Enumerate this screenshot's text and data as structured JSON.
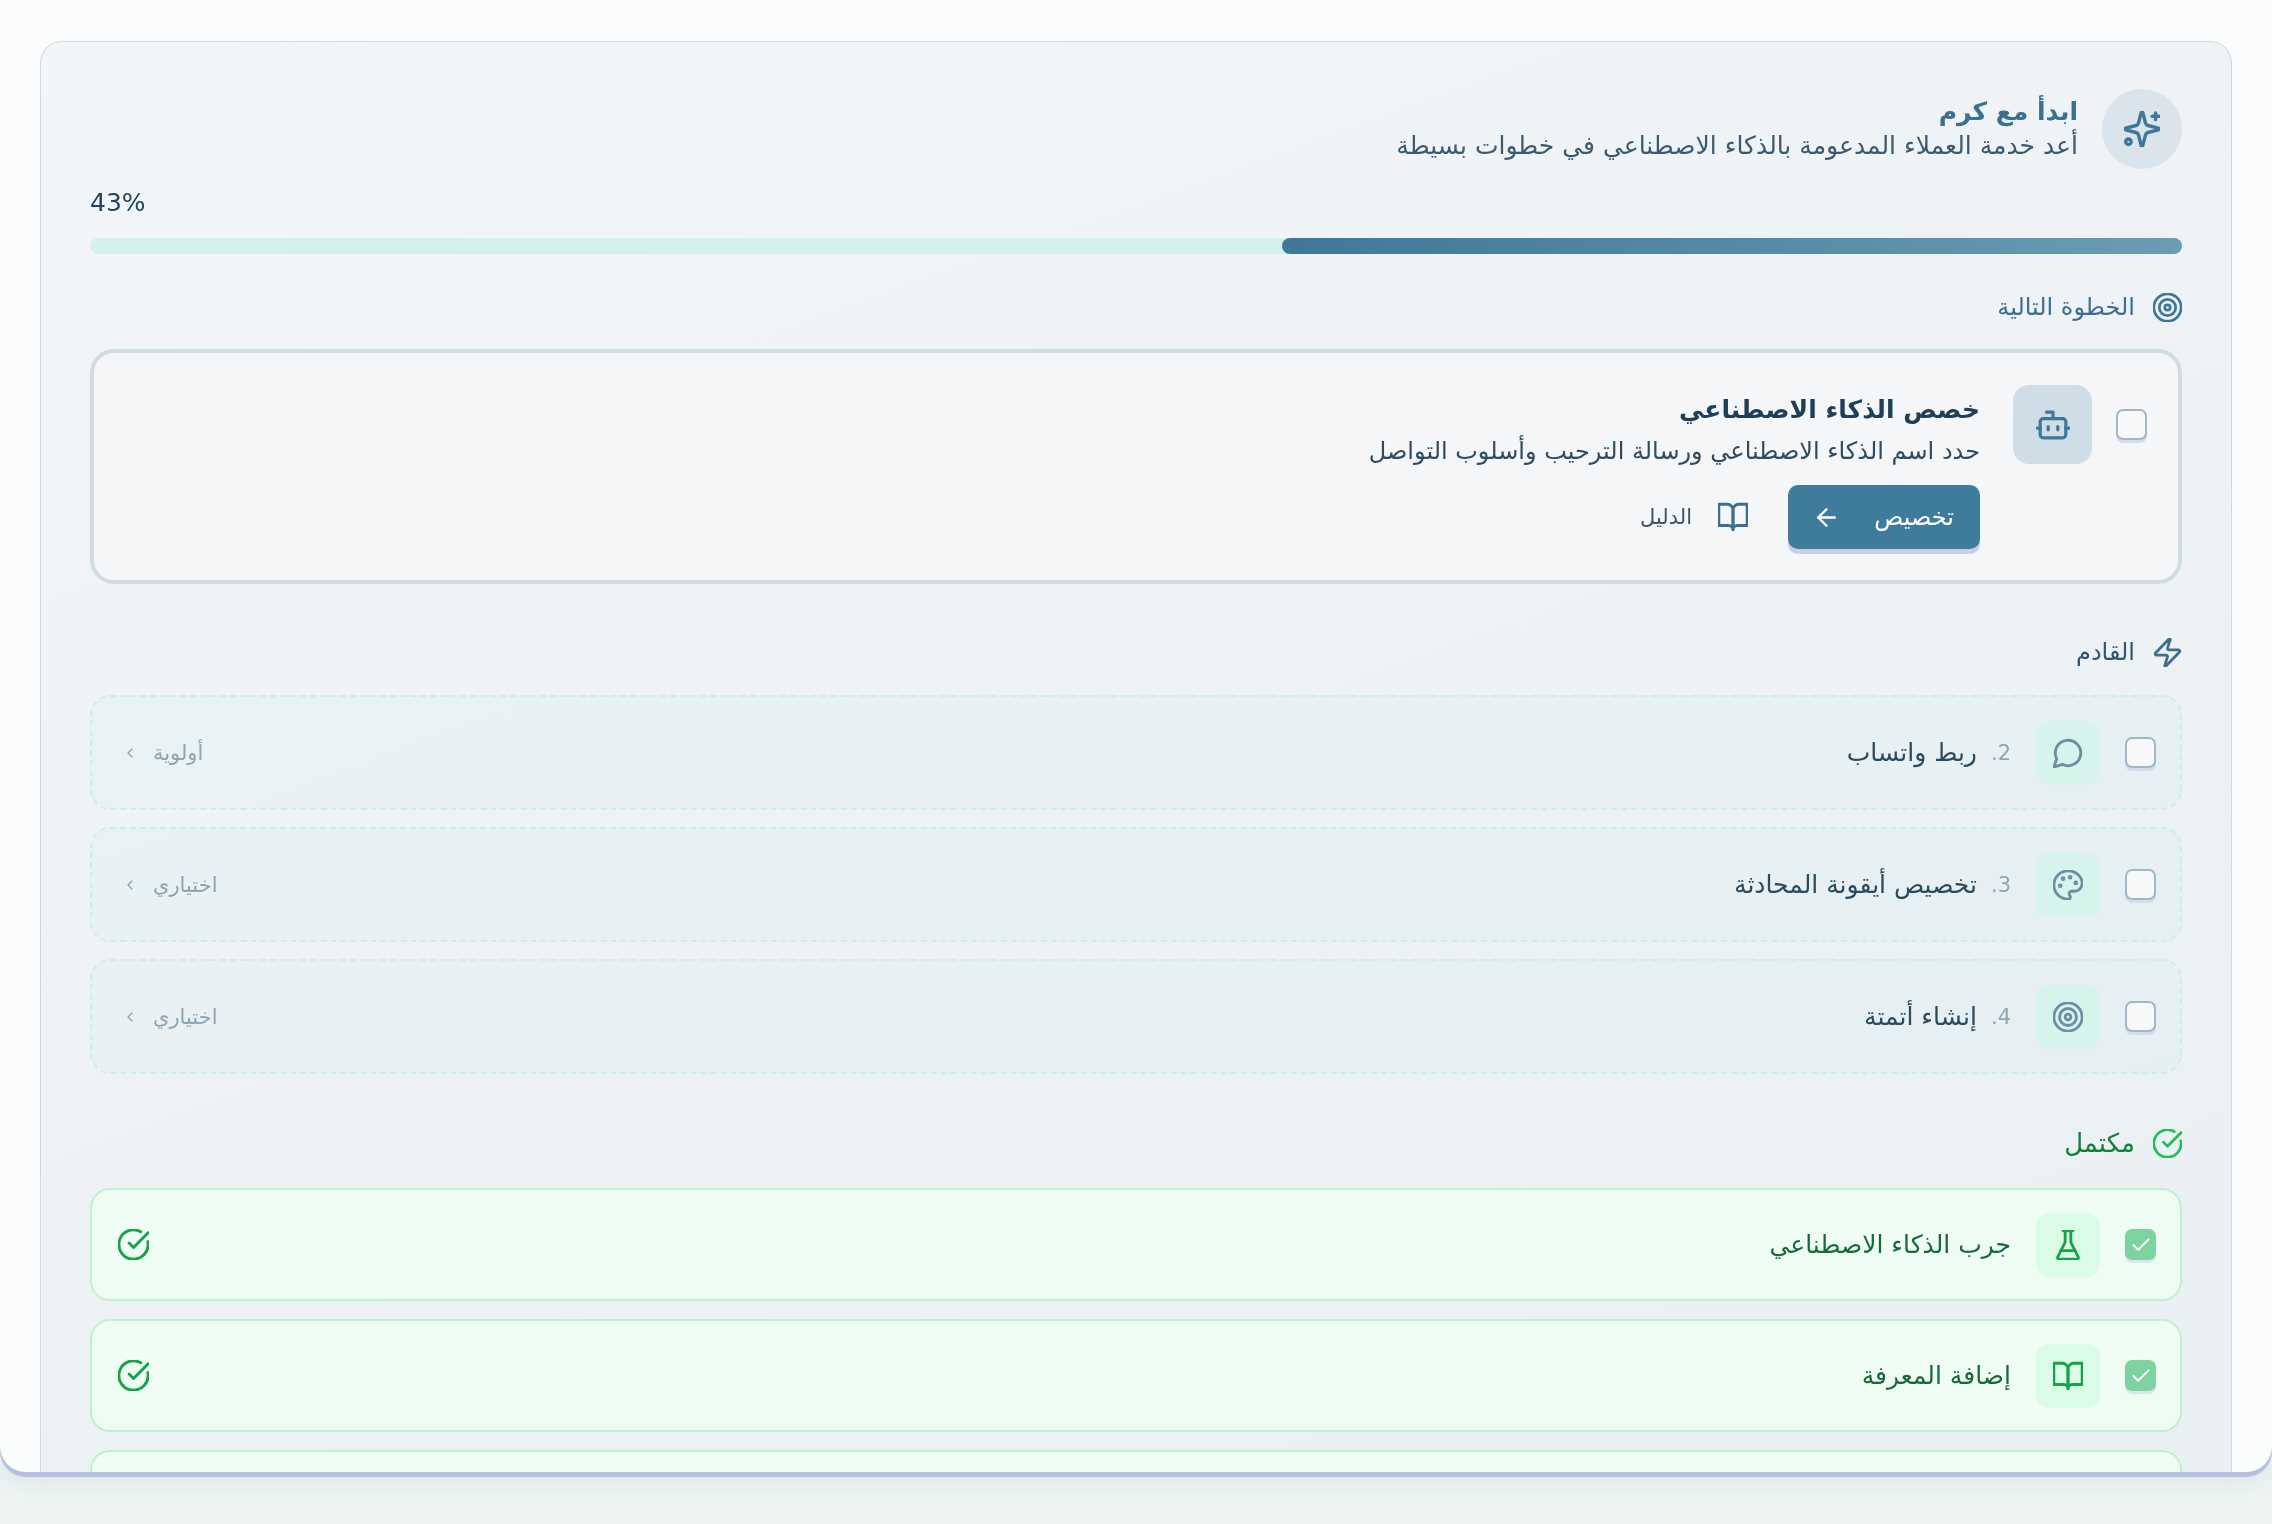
{
  "header": {
    "title": "ابدأ مع كرم",
    "subtitle": "أعد خدمة العملاء المدعومة بالذكاء الاصطناعي في خطوات بسيطة"
  },
  "progress": {
    "label": "43%",
    "level": 0.43
  },
  "next_step": {
    "heading": "الخطوة التالية",
    "task": {
      "kind": "assistant",
      "checked": false,
      "title": "خصص الذكاء الاصطناعي",
      "description": "حدد اسم الذكاء الاصطناعي ورسالة الترحيب وأسلوب التواصل",
      "action": "تخصيص",
      "guide": "الدليل"
    }
  },
  "upcoming": {
    "heading": "القادم",
    "items": [
      {
        "kind": "messaging",
        "checked": false,
        "number": "2.",
        "title": "ربط واتساب",
        "tag": "أولوية"
      },
      {
        "kind": "branding",
        "checked": false,
        "number": "3.",
        "title": "تخصيص أيقونة المحادثة",
        "tag": "اختياري"
      },
      {
        "kind": "automation",
        "checked": false,
        "number": "4.",
        "title": "إنشاء أتمتة",
        "tag": "اختياري"
      }
    ]
  },
  "completed": {
    "heading": "مكتمل",
    "items": [
      {
        "kind": "testing",
        "checked": true,
        "title": "جرب الذكاء الاصطناعي"
      },
      {
        "kind": "knowledge",
        "checked": true,
        "title": "إضافة المعرفة"
      }
    ],
    "more_below": true
  }
}
